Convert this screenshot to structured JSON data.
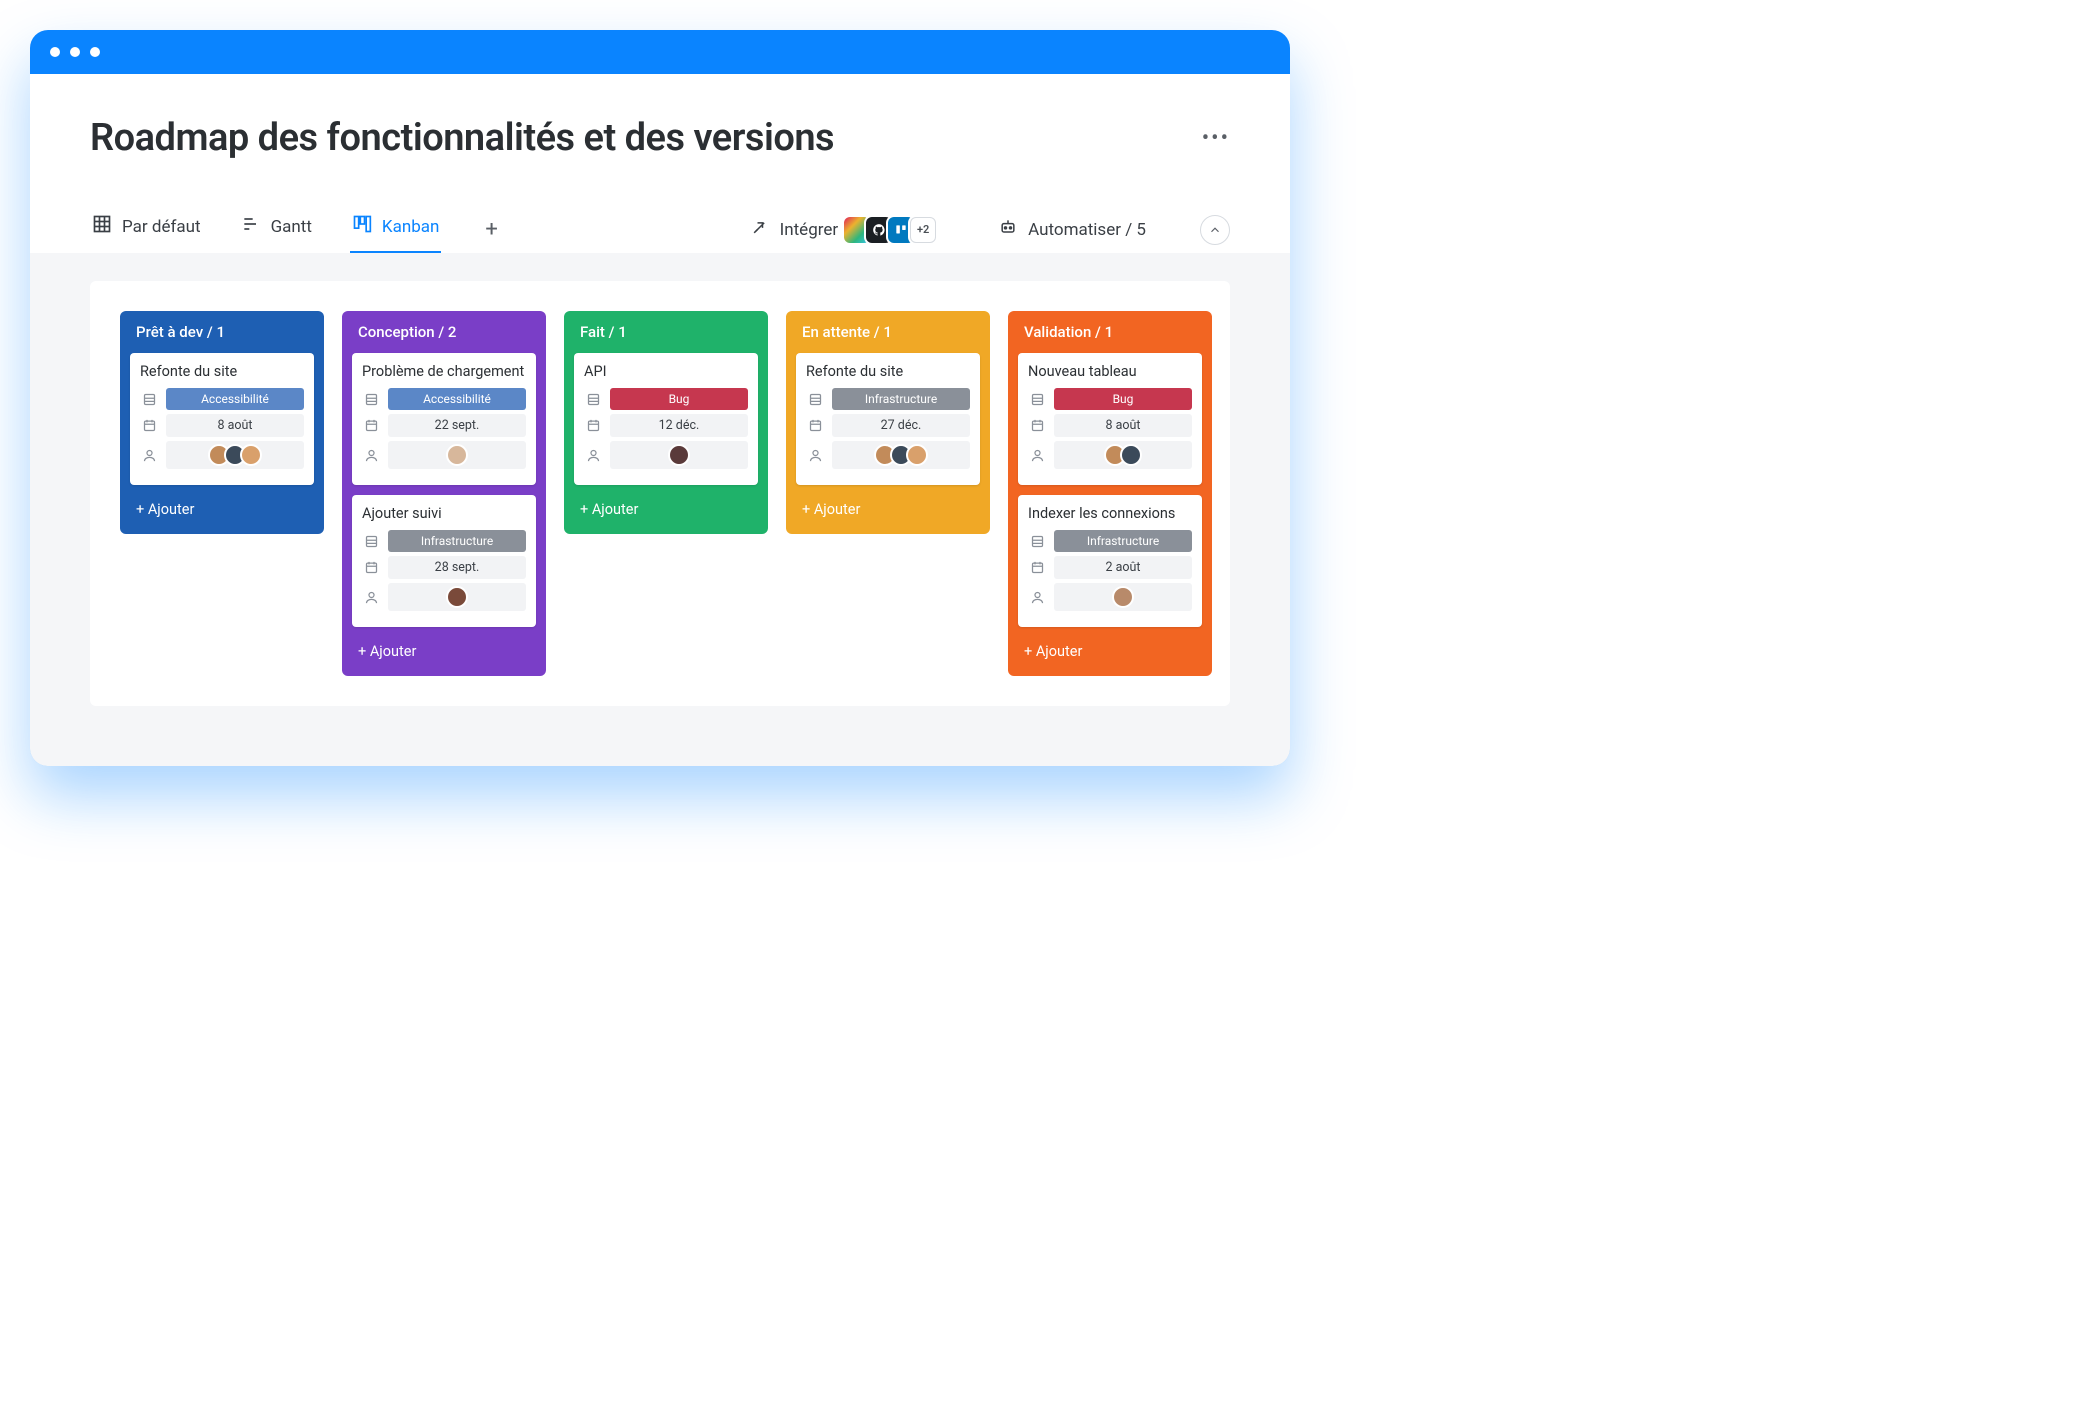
{
  "page_title": "Roadmap des fonctionnalités et des versions",
  "views": {
    "default": "Par défaut",
    "gantt": "Gantt",
    "kanban": "Kanban"
  },
  "active_view": "Kanban",
  "integrate_label": "Intégrer",
  "integrations_more": "+2",
  "automate_label": "Automatiser / 5",
  "add_card_label": "+ Ajouter",
  "tag_colors": {
    "Accessibilité": "#5b87c7",
    "Bug": "#c6374f",
    "Infrastructure": "#8a9099"
  },
  "columns": [
    {
      "title": "Prêt à dev / 1",
      "color": "#1e5fb3",
      "cards": [
        {
          "title": "Refonte du site",
          "tag": "Accessibilité",
          "date": "8 août",
          "avatars": [
            "#c28b5a",
            "#3b4a5a",
            "#d9a06b"
          ]
        }
      ]
    },
    {
      "title": "Conception / 2",
      "color": "#7a3ec7",
      "cards": [
        {
          "title": "Problème de chargement",
          "tag": "Accessibilité",
          "date": "22 sept.",
          "avatars": [
            "#d7b79b"
          ]
        },
        {
          "title": "Ajouter suivi",
          "tag": "Infrastructure",
          "date": "28 sept.",
          "avatars": [
            "#7a4a3a"
          ]
        }
      ]
    },
    {
      "title": "Fait / 1",
      "color": "#1fb26a",
      "cards": [
        {
          "title": "API",
          "tag": "Bug",
          "date": "12 déc.",
          "avatars": [
            "#5a3a3a"
          ]
        }
      ]
    },
    {
      "title": "En attente / 1",
      "color": "#f0a826",
      "cards": [
        {
          "title": "Refonte du site",
          "tag": "Infrastructure",
          "date": "27 déc.",
          "avatars": [
            "#c28b5a",
            "#3b4a5a",
            "#d9a06b"
          ]
        }
      ]
    },
    {
      "title": "Validation / 1",
      "color": "#f26522",
      "cards": [
        {
          "title": "Nouveau tableau",
          "tag": "Bug",
          "date": "8 août",
          "avatars": [
            "#c28b5a",
            "#3b4a5a"
          ]
        },
        {
          "title": "Indexer les connexions",
          "tag": "Infrastructure",
          "date": "2 août",
          "avatars": [
            "#b88a6a"
          ]
        }
      ]
    }
  ]
}
